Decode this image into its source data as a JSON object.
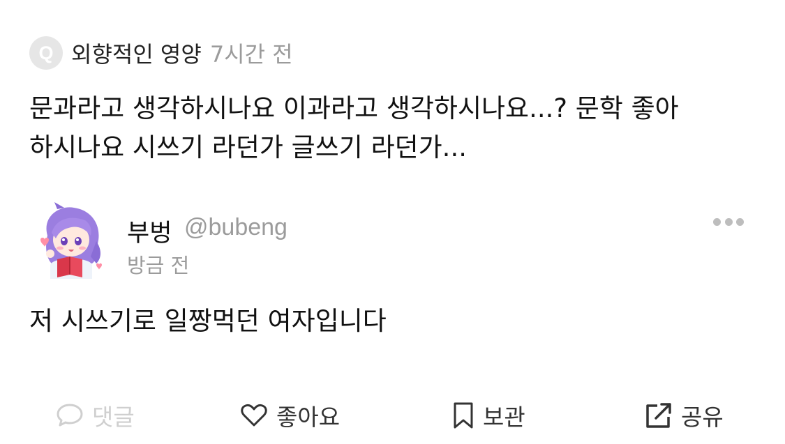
{
  "question": {
    "badge_icon": "q-badge-icon",
    "badge_letter": "Q",
    "author": "외향적인 영양",
    "time": "7시간 전",
    "text_line1": "문과라고 생각하시나요 이과라고 생각하시나요...? 문학 좋아",
    "text_line2": "하시나요 시쓰기 라던가 글쓰기 라던가..."
  },
  "answer": {
    "avatar_icon": "anime-girl-reading-avatar",
    "author_name": "부벙",
    "author_handle": "@bubeng",
    "time": "방금 전",
    "text": "저 시쓰기로 일짱먹던 여자입니다"
  },
  "actions": {
    "comment_label": "댓글",
    "like_label": "좋아요",
    "save_label": "보관",
    "share_label": "공유"
  },
  "colors": {
    "primary_text": "#111111",
    "secondary_text": "#9b9b9b",
    "disabled": "#cfcfcf",
    "badge_bg": "#e6e6e6",
    "accent_purple": "#9b7ee0"
  }
}
